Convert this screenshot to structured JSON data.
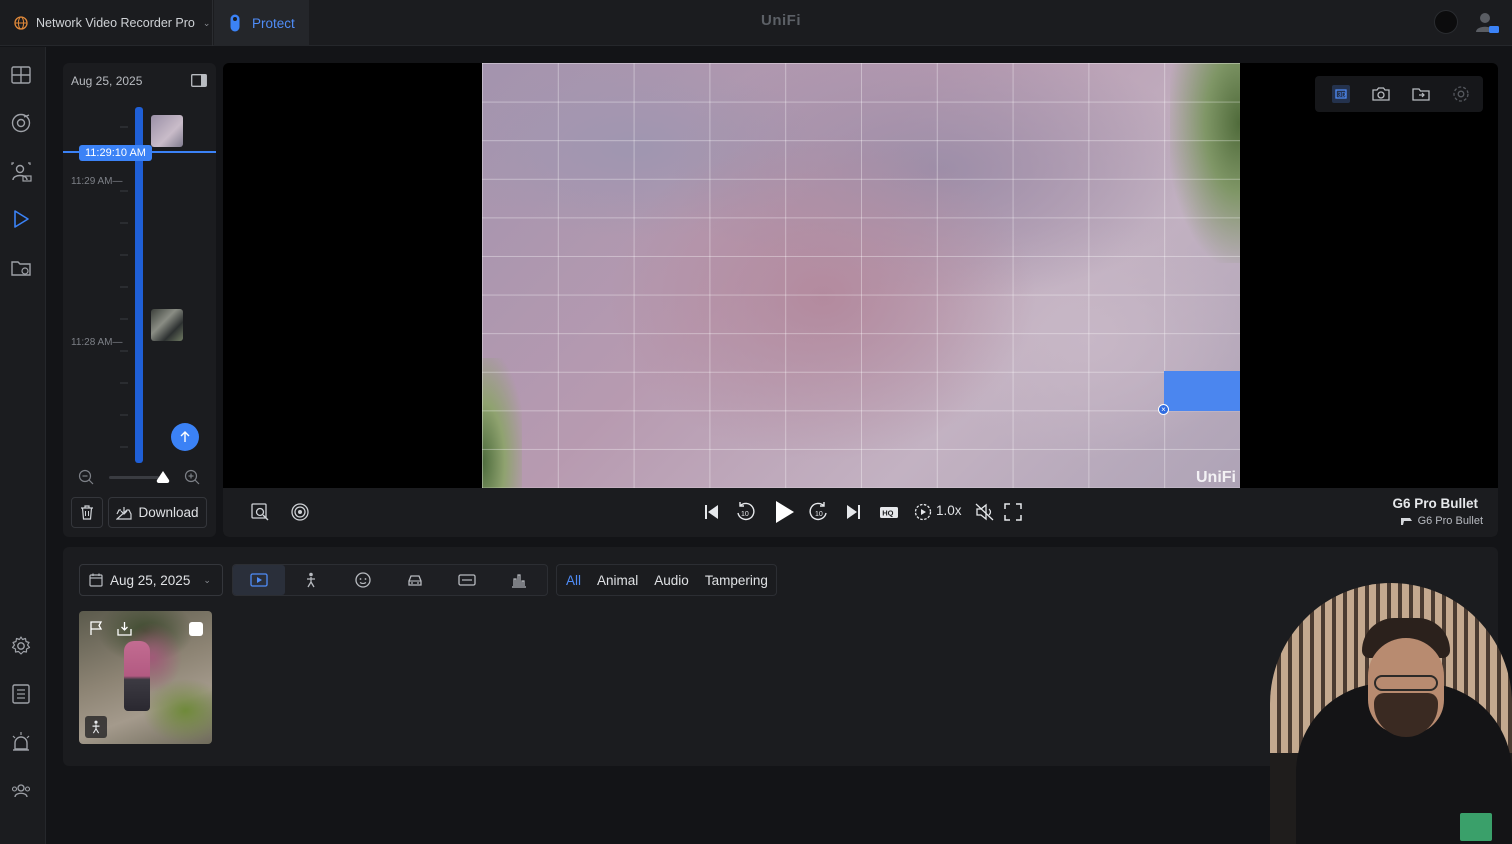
{
  "topbar": {
    "app_name": "Network Video Recorder Pro",
    "active_tab": "Protect",
    "brand": "UniFi"
  },
  "sidebar": {
    "items": [
      {
        "name": "dashboard",
        "icon": "grid-icon"
      },
      {
        "name": "devices",
        "icon": "camera-lens-icon"
      },
      {
        "name": "alarm-manager",
        "icon": "detections-icon"
      },
      {
        "name": "recordings",
        "icon": "play-icon",
        "active": true
      },
      {
        "name": "exports",
        "icon": "folder-icon"
      },
      {
        "name": "settings",
        "icon": "gear-icon"
      },
      {
        "name": "logs",
        "icon": "list-icon"
      },
      {
        "name": "alarms",
        "icon": "siren-icon"
      },
      {
        "name": "users",
        "icon": "users-icon"
      }
    ]
  },
  "timeline": {
    "date": "Aug 25, 2025",
    "current_time": "11:29:10 AM",
    "label_1": "11:29 AM",
    "label_2": "11:28 AM",
    "download_label": "Download"
  },
  "player": {
    "watermark": "UniFi",
    "speed": "1.0x",
    "camera_name": "G6 Pro Bullet",
    "camera_sub": "G6 Pro Bullet",
    "quality_badge": "HQ",
    "skip_back": "10",
    "skip_forward": "10"
  },
  "events": {
    "date": "Aug 25, 2025",
    "type_filters": [
      "All",
      "Animal",
      "Audio",
      "Tampering"
    ],
    "active_type": "All"
  },
  "colors": {
    "accent": "#3b82f6",
    "background": "#131417",
    "panel": "#1b1c1f"
  }
}
